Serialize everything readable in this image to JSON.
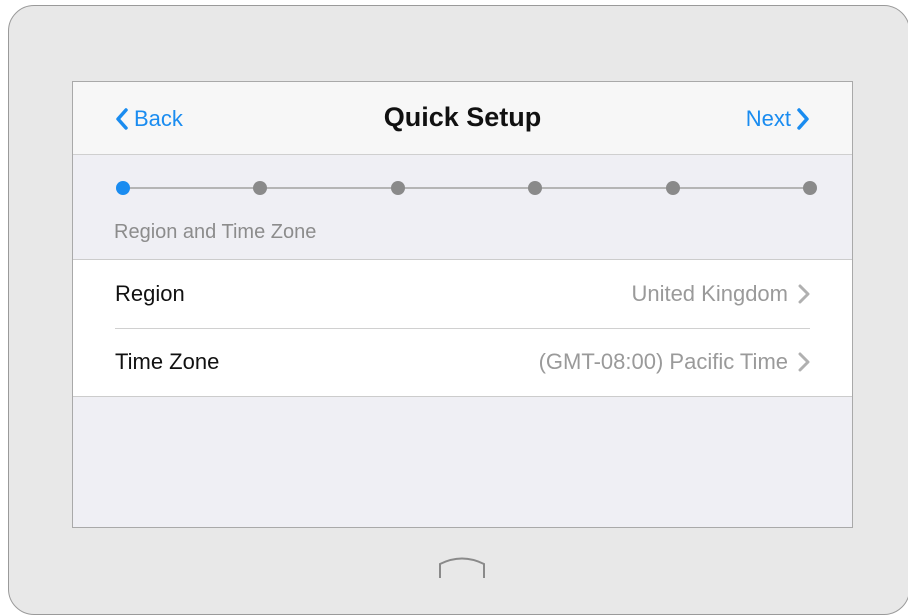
{
  "navbar": {
    "back_label": "Back",
    "title": "Quick Setup",
    "next_label": "Next"
  },
  "stepper": {
    "total_steps": 6,
    "current_step": 1
  },
  "section": {
    "label": "Region and Time Zone"
  },
  "settings": [
    {
      "label": "Region",
      "value": "United Kingdom"
    },
    {
      "label": "Time Zone",
      "value": "(GMT-08:00) Pacific Time"
    }
  ],
  "colors": {
    "accent": "#1a8cf0",
    "inactive_dot": "#8a8a8a",
    "secondary_text": "#9a9a9a"
  },
  "icons": {
    "back": "chevron-left-icon",
    "next": "chevron-right-icon",
    "row_disclosure": "chevron-right-icon",
    "home": "home-button-icon"
  }
}
